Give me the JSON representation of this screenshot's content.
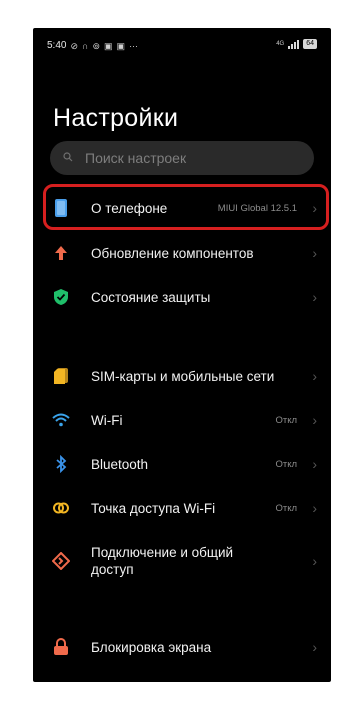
{
  "status_bar": {
    "time": "5:40",
    "notification_icons": [
      "download-off-icon",
      "headphones-icon",
      "vpn-icon",
      "twitch-icon",
      "twitch-icon"
    ],
    "more": "···",
    "network_label": "4G",
    "battery": "64"
  },
  "page": {
    "title": "Настройки"
  },
  "search": {
    "placeholder": "Поиск настроек"
  },
  "items": [
    {
      "label": "О телефоне",
      "value": "MIUI Global 12.5.1",
      "icon": "phone-icon",
      "icon_color": "#4a9eea"
    },
    {
      "label": "Обновление компонентов",
      "value": "",
      "icon": "arrow-up-icon",
      "icon_color": "#f06a4b"
    },
    {
      "label": "Состояние защиты",
      "value": "",
      "icon": "shield-check-icon",
      "icon_color": "#1fbf6a"
    },
    {
      "label": "SIM-карты и мобильные сети",
      "value": "",
      "icon": "sim-icon",
      "icon_color": "#f3b623"
    },
    {
      "label": "Wi-Fi",
      "value": "Откл",
      "icon": "wifi-icon",
      "icon_color": "#3aa3ea"
    },
    {
      "label": "Bluetooth",
      "value": "Откл",
      "icon": "bluetooth-icon",
      "icon_color": "#3a93ea"
    },
    {
      "label": "Точка доступа Wi-Fi",
      "value": "Откл",
      "icon": "hotspot-icon",
      "icon_color": "#f3b623"
    },
    {
      "label_line1": "Подключение и общий",
      "label_line2": "доступ",
      "value": "",
      "icon": "share-icon",
      "icon_color": "#f06a4b"
    },
    {
      "label": "Блокировка экрана",
      "value": "",
      "icon": "lock-icon",
      "icon_color": "#f06a4b"
    }
  ],
  "chevron": "›",
  "colors": {
    "background": "#000000",
    "highlight": "#d61f1f",
    "search_bg": "#2a2a2a"
  }
}
